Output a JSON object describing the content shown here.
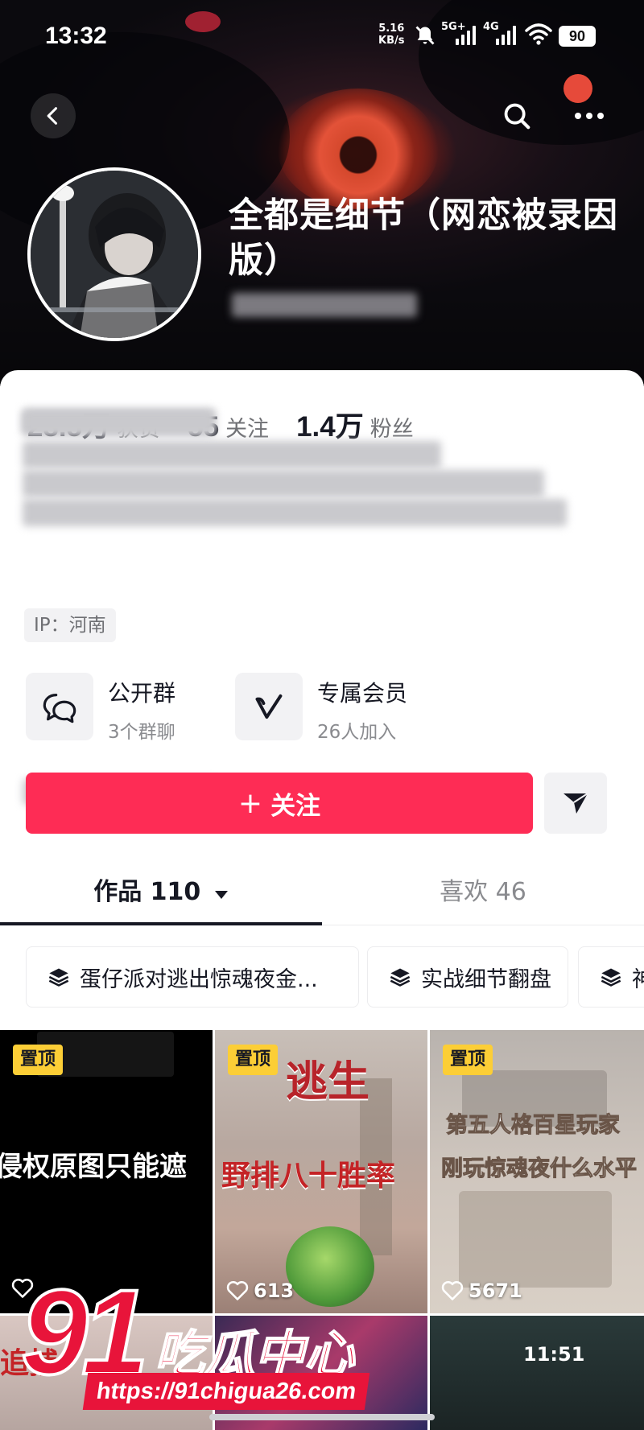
{
  "status_bar": {
    "time": "13:32",
    "speed_value": "5.16",
    "speed_unit": "KB/s",
    "sig1": "5G+",
    "sig2": "4G",
    "battery": "90"
  },
  "profile": {
    "name": "全都是细节（网恋被录因版）",
    "stats": [
      {
        "value": "23.5万",
        "label": "获赞"
      },
      {
        "value": "55",
        "label": "关注"
      },
      {
        "value": "1.4万",
        "label": "粉丝"
      }
    ],
    "ip_label": "IP：河南"
  },
  "features": [
    {
      "title": "公开群",
      "subtitle": "3个群聊",
      "icon": "chat-bubbles-icon"
    },
    {
      "title": "专属会员",
      "subtitle": "26人加入",
      "icon": "v-badge-icon"
    }
  ],
  "actions": {
    "follow_label": "关注",
    "follow_icon": "+",
    "share_icon": "paper-plane-icon"
  },
  "tabs": {
    "works": "作品 110",
    "likes": "喜欢 46"
  },
  "collections": [
    "蛋仔派对逃出惊魂夜金...",
    "实战细节翻盘",
    "神"
  ],
  "grid": [
    {
      "pinned": "置顶",
      "overlay": "侵权原图只能遮",
      "likes": ""
    },
    {
      "pinned": "置顶",
      "overlay_top": "逃生",
      "overlay": "野排八十胜率",
      "likes": "613"
    },
    {
      "pinned": "置顶",
      "overlay_top": "第五人格百星玩家",
      "overlay": "刚玩惊魂夜什么水平",
      "likes": "5671"
    },
    {
      "pinned": "",
      "overlay": "追捕",
      "likes": ""
    },
    {
      "pinned": "",
      "overlay": "",
      "likes": ""
    },
    {
      "pinned": "",
      "overlay": "11:51",
      "likes": ""
    }
  ],
  "watermark": {
    "logo_num": "91",
    "logo_text": "吃瓜中心",
    "url": "https://91chigua26.com"
  },
  "colors": {
    "accent": "#fe2c55",
    "pin_badge": "#fcce36",
    "watermark": "#e8143a"
  }
}
